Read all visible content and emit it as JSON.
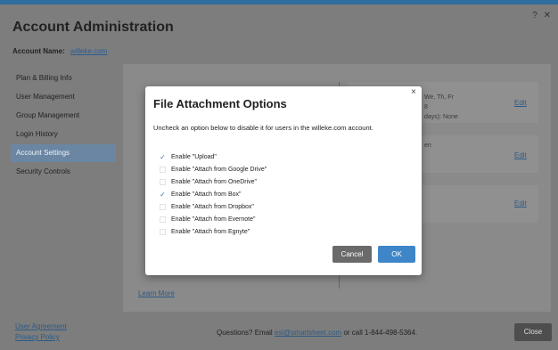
{
  "header": {
    "title": "Account Administration",
    "help": "?",
    "close": "✕"
  },
  "account": {
    "label": "Account Name:",
    "value": "willeke.com"
  },
  "sidebar": {
    "items": [
      {
        "label": "Plan & Billing Info"
      },
      {
        "label": "User Management"
      },
      {
        "label": "Group Management"
      },
      {
        "label": "Login History"
      },
      {
        "label": "Account Settings"
      },
      {
        "label": "Security Controls"
      }
    ]
  },
  "background": {
    "days_text": "We, Th, Fr",
    "num_text": "8",
    "days_none": "days): None",
    "en_text": "en",
    "edit_label": "Edit"
  },
  "learn_more": "Learn More",
  "footer": {
    "user_agreement": "User Agreement",
    "privacy_policy": "Privacy Policy",
    "questions_prefix": "Questions? Email",
    "email": "esl@smartsheet.com",
    "questions_suffix": "or call 1-844-498-5364.",
    "close_label": "Close"
  },
  "modal": {
    "title": "File Attachment Options",
    "close": "×",
    "description": "Uncheck an option below to disable it for users in the willeke.com account.",
    "options": [
      {
        "label": "Enable \"Upload\"",
        "checked": true
      },
      {
        "label": "Enable \"Attach from Google Drive\"",
        "checked": false
      },
      {
        "label": "Enable \"Attach from OneDrive\"",
        "checked": false
      },
      {
        "label": "Enable \"Attach from Box\"",
        "checked": true
      },
      {
        "label": "Enable \"Attach from Dropbox\"",
        "checked": false
      },
      {
        "label": "Enable \"Attach from Evernote\"",
        "checked": false
      },
      {
        "label": "Enable \"Attach from Egnyte\"",
        "checked": false
      }
    ],
    "cancel_label": "Cancel",
    "ok_label": "OK"
  },
  "colors": {
    "accent": "#3f86c8",
    "active_nav": "#6a86a3"
  }
}
